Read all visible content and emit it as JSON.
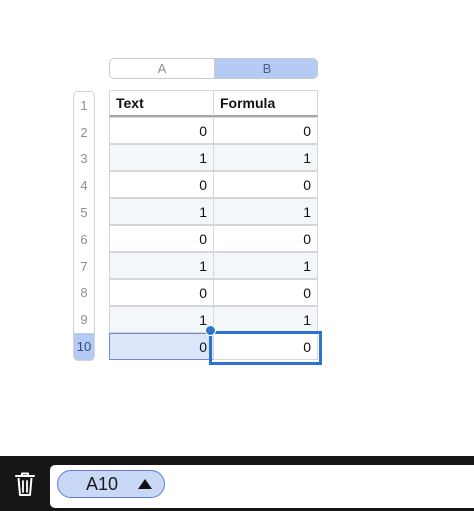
{
  "columns": [
    "A",
    "B"
  ],
  "rows": [
    "1",
    "2",
    "3",
    "4",
    "5",
    "6",
    "7",
    "8",
    "9",
    "10"
  ],
  "selected_row": "10",
  "table": {
    "headers": [
      "Text",
      "Formula"
    ],
    "data": [
      [
        "0",
        "0"
      ],
      [
        "1",
        "1"
      ],
      [
        "0",
        "0"
      ],
      [
        "1",
        "1"
      ],
      [
        "0",
        "0"
      ],
      [
        "1",
        "1"
      ],
      [
        "0",
        "0"
      ],
      [
        "1",
        "1"
      ],
      [
        "0",
        "0"
      ]
    ]
  },
  "bottom_bar": {
    "cell_reference": "A10",
    "trash_icon": "trash-icon",
    "dropdown_icon": "triangle-up-icon"
  },
  "colors": {
    "selection_blue": "#2b73cf",
    "header_highlight": "#b5cbf3"
  }
}
